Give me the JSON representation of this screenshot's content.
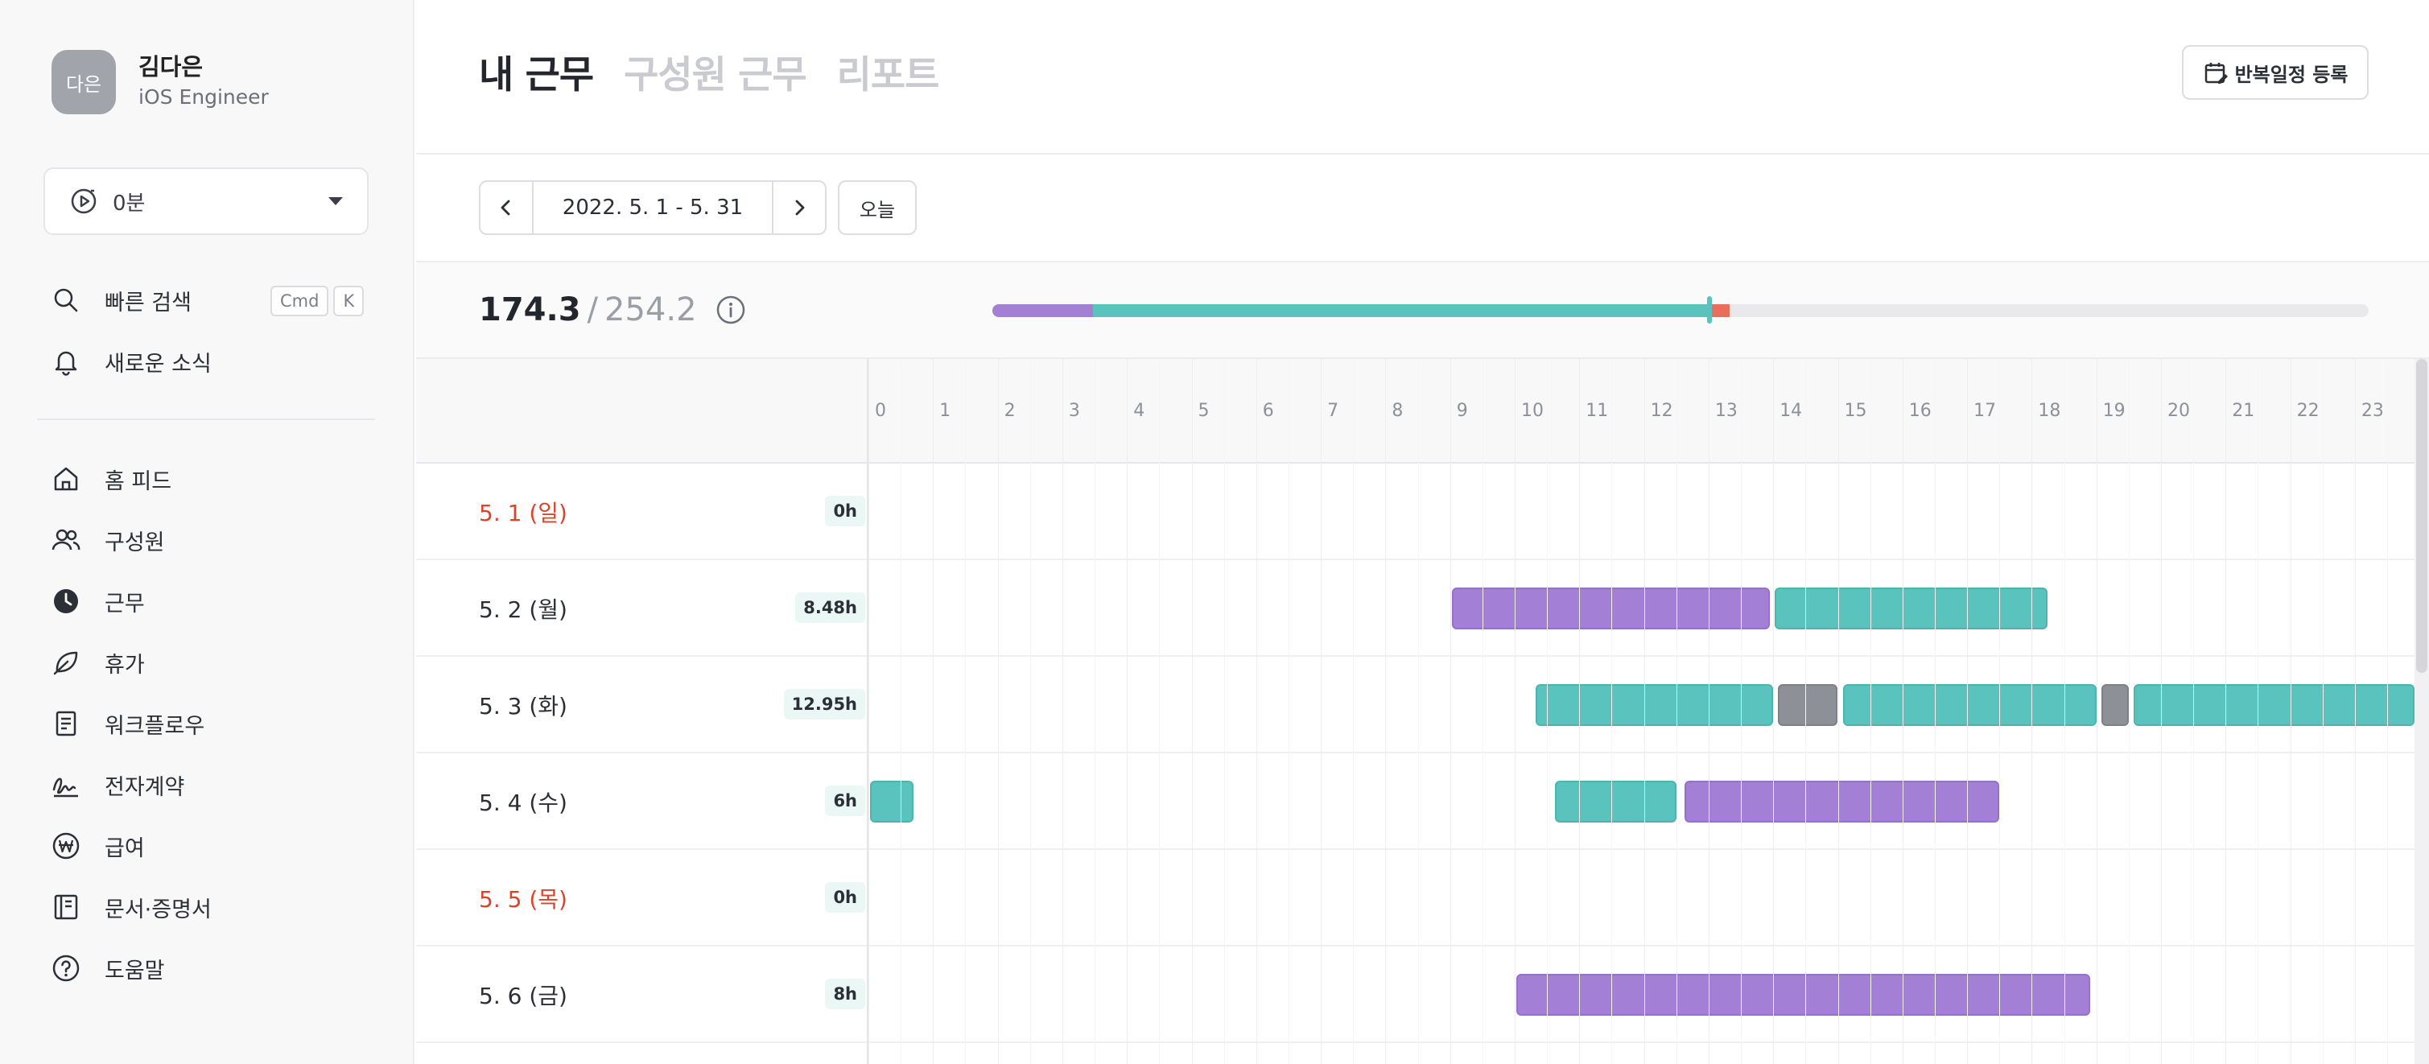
{
  "profile": {
    "avatar_text": "다은",
    "name": "김다은",
    "role": "iOS Engineer"
  },
  "timer": {
    "value": "0분"
  },
  "sidebar": {
    "quick_search": "빠른 검색",
    "kbd_cmd": "Cmd",
    "kbd_k": "K",
    "news": "새로운 소식",
    "items": [
      {
        "label": "홈 피드",
        "icon": "home-icon"
      },
      {
        "label": "구성원",
        "icon": "people-icon"
      },
      {
        "label": "근무",
        "icon": "clock-icon"
      },
      {
        "label": "휴가",
        "icon": "leaf-icon"
      },
      {
        "label": "워크플로우",
        "icon": "document-icon"
      },
      {
        "label": "전자계약",
        "icon": "signature-icon"
      },
      {
        "label": "급여",
        "icon": "won-icon"
      },
      {
        "label": "문서·증명서",
        "icon": "book-icon"
      },
      {
        "label": "도움말",
        "icon": "help-icon"
      }
    ]
  },
  "header": {
    "tabs": [
      {
        "label": "내 근무",
        "active": true
      },
      {
        "label": "구성원 근무",
        "active": false
      },
      {
        "label": "리포트",
        "active": false
      }
    ],
    "repeat_button": "반복일정 등록"
  },
  "date_nav": {
    "range": "2022. 5. 1 - 5. 31",
    "today": "오늘"
  },
  "summary": {
    "worked": "174.3",
    "slash": "/",
    "target": "254.2",
    "progress_segments": [
      {
        "color": "#a47fd6",
        "hours": 18.6
      },
      {
        "color": "#5ac3bd",
        "hours": 113.9
      },
      {
        "color": "#e8705a",
        "hours": 3.6
      }
    ],
    "marker_color": "#5ac3bd"
  },
  "timeline": {
    "hours": [
      "0",
      "1",
      "2",
      "3",
      "4",
      "5",
      "6",
      "7",
      "8",
      "9",
      "10",
      "11",
      "12",
      "13",
      "14",
      "15",
      "16",
      "17",
      "18",
      "19",
      "20",
      "21",
      "22",
      "23"
    ],
    "rows": [
      {
        "date": "5. 1 (일)",
        "hours": "0h",
        "holiday": true,
        "bars": []
      },
      {
        "date": "5. 2 (월)",
        "hours": "8.48h",
        "holiday": false,
        "bars": [
          {
            "start": 9.0,
            "end": 13.95,
            "type": "purple"
          },
          {
            "start": 14.0,
            "end": 18.25,
            "type": "teal"
          }
        ]
      },
      {
        "date": "5. 3 (화)",
        "hours": "12.95h",
        "holiday": false,
        "bars": [
          {
            "start": 10.3,
            "end": 14.0,
            "type": "teal"
          },
          {
            "start": 14.05,
            "end": 15.0,
            "type": "gray"
          },
          {
            "start": 15.05,
            "end": 19.0,
            "type": "teal"
          },
          {
            "start": 19.05,
            "end": 19.5,
            "type": "gray"
          },
          {
            "start": 19.55,
            "end": 24.0,
            "type": "teal"
          }
        ]
      },
      {
        "date": "5. 4 (수)",
        "hours": "6h",
        "holiday": false,
        "bars": [
          {
            "start": 0.0,
            "end": 0.7,
            "type": "teal"
          },
          {
            "start": 10.6,
            "end": 12.5,
            "type": "teal"
          },
          {
            "start": 12.6,
            "end": 17.5,
            "type": "purple"
          }
        ]
      },
      {
        "date": "5. 5 (목)",
        "hours": "0h",
        "holiday": true,
        "bars": []
      },
      {
        "date": "5. 6 (금)",
        "hours": "8h",
        "holiday": false,
        "bars": [
          {
            "start": 10.0,
            "end": 18.9,
            "type": "purple"
          }
        ]
      }
    ]
  }
}
